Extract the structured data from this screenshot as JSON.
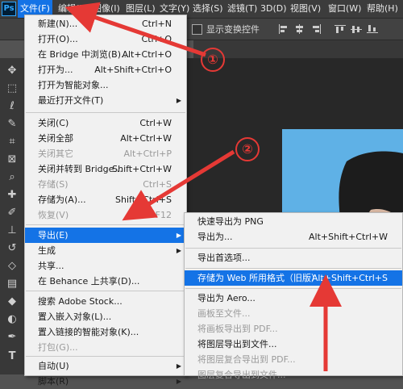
{
  "app": {
    "logo": "Ps"
  },
  "menubar": {
    "items": [
      {
        "label": "文件(F)",
        "active": true
      },
      {
        "label": "编辑(E)"
      },
      {
        "label": "图像(I)"
      },
      {
        "label": "图层(L)"
      },
      {
        "label": "文字(Y)"
      },
      {
        "label": "选择(S)"
      },
      {
        "label": "滤镜(T)"
      },
      {
        "label": "3D(D)"
      },
      {
        "label": "视图(V)"
      },
      {
        "label": "窗口(W)"
      },
      {
        "label": "帮助(H)"
      }
    ]
  },
  "options": {
    "show_transform_controls": "显示变换控件",
    "checked": false
  },
  "file_menu": {
    "items": [
      {
        "label": "新建(N)...",
        "shortcut": "Ctrl+N"
      },
      {
        "label": "打开(O)...",
        "shortcut": "Ctrl+O"
      },
      {
        "label": "在 Bridge 中浏览(B)...",
        "shortcut": "Alt+Ctrl+O"
      },
      {
        "label": "打开为...",
        "shortcut": "Alt+Shift+Ctrl+O"
      },
      {
        "label": "打开为智能对象..."
      },
      {
        "label": "最近打开文件(T)",
        "submenu": true
      },
      {
        "label": "关闭(C)",
        "shortcut": "Ctrl+W"
      },
      {
        "label": "关闭全部",
        "shortcut": "Alt+Ctrl+W"
      },
      {
        "label": "关闭其它",
        "shortcut": "Alt+Ctrl+P",
        "disabled": true
      },
      {
        "label": "关闭并转到 Bridge...",
        "shortcut": "Shift+Ctrl+W"
      },
      {
        "label": "存储(S)",
        "shortcut": "Ctrl+S",
        "disabled": true
      },
      {
        "label": "存储为(A)...",
        "shortcut": "Shift+Ctrl+S"
      },
      {
        "label": "恢复(V)",
        "shortcut": "F12",
        "disabled": true
      },
      {
        "label": "导出(E)",
        "submenu": true,
        "highlighted": true
      },
      {
        "label": "生成",
        "submenu": true
      },
      {
        "label": "共享..."
      },
      {
        "label": "在 Behance 上共享(D)..."
      },
      {
        "label": "搜索 Adobe Stock..."
      },
      {
        "label": "置入嵌入对象(L)..."
      },
      {
        "label": "置入链接的智能对象(K)..."
      },
      {
        "label": "打包(G)...",
        "disabled": true
      },
      {
        "label": "自动(U)",
        "submenu": true
      },
      {
        "label": "脚本(R)",
        "submenu": true
      }
    ]
  },
  "export_menu": {
    "items": [
      {
        "label": "快速导出为 PNG"
      },
      {
        "label": "导出为...",
        "shortcut": "Alt+Shift+Ctrl+W"
      },
      {
        "label": "导出首选项..."
      },
      {
        "label": "存储为 Web 所用格式（旧版）...",
        "shortcut": "Alt+Shift+Ctrl+S",
        "highlighted": true
      },
      {
        "label": "导出为 Aero..."
      },
      {
        "label": "画板至文件...",
        "disabled": true
      },
      {
        "label": "将画板导出到 PDF...",
        "disabled": true
      },
      {
        "label": "将图层导出到文件..."
      },
      {
        "label": "将图层复合导出到 PDF...",
        "disabled": true
      },
      {
        "label": "图层复合导出到文件...",
        "disabled": true
      }
    ]
  },
  "annotations": [
    {
      "label": "①"
    },
    {
      "label": "②"
    }
  ],
  "colors": {
    "highlight": "#1473e6",
    "annotation": "#e53935",
    "photo_background": "#5fb1e6"
  },
  "tools": [
    "move-icon",
    "marquee-icon",
    "lasso-icon",
    "quick-select-icon",
    "crop-icon",
    "frame-icon",
    "eyedropper-icon",
    "healing-icon",
    "brush-icon",
    "stamp-icon",
    "history-brush-icon",
    "eraser-icon",
    "gradient-icon",
    "blur-icon",
    "dodge-icon",
    "pen-icon",
    "type-icon"
  ]
}
